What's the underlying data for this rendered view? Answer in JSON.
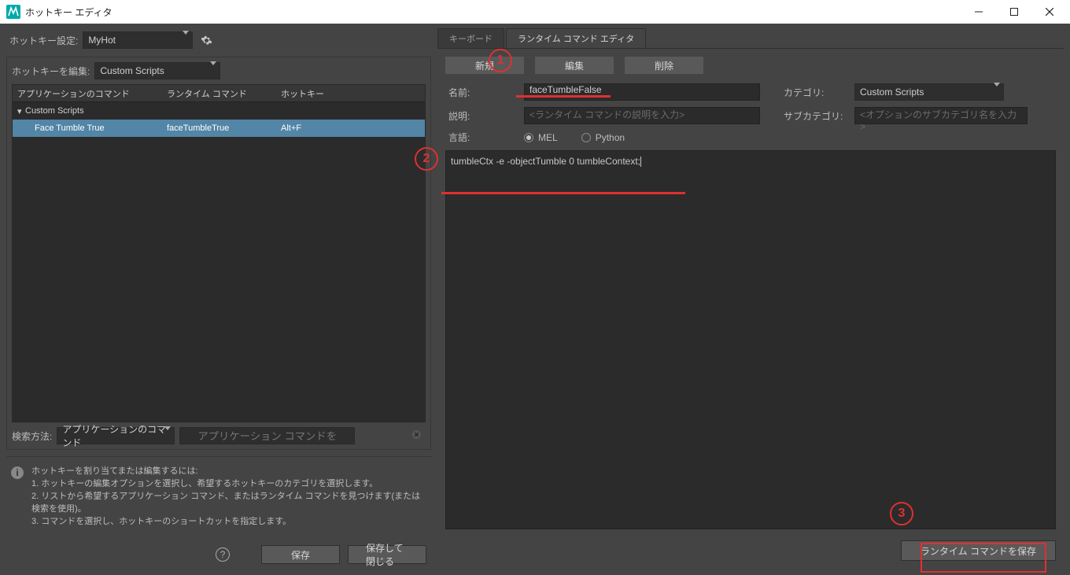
{
  "window": {
    "title": "ホットキー エディタ"
  },
  "hotkeySet": {
    "label": "ホットキー設定:",
    "value": "MyHot"
  },
  "editHotkey": {
    "label": "ホットキーを編集:",
    "value": "Custom Scripts"
  },
  "listHeader": {
    "col1": "アプリケーションのコマンド",
    "col2": "ランタイム コマンド",
    "col3": "ホットキー"
  },
  "tree": {
    "group": "Custom Scripts",
    "row": {
      "name": "Face Tumble True",
      "runtime": "faceTumbleTrue",
      "hotkey": "Alt+F"
    }
  },
  "searchBy": {
    "label": "検索方法:",
    "value": "アプリケーションのコマンド",
    "placeholder": "アプリケーション コマンドを入力..."
  },
  "help": {
    "title": "ホットキーを割り当てまたは編集するには:",
    "l1": "1. ホットキーの編集オプションを選択し、希望するホットキーのカテゴリを選択します。",
    "l2": "2. リストから希望するアプリケーション コマンド、またはランタイム コマンドを見つけます(または検索を使用)。",
    "l3": "3. コマンドを選択し、ホットキーのショートカットを指定します。"
  },
  "buttons": {
    "save": "保存",
    "saveClose": "保存して閉じる",
    "saveRuntime": "ランタイム コマンドを保存"
  },
  "tabs": {
    "keyboard": "キーボード",
    "runtime": "ランタイム コマンド エディタ"
  },
  "actionButtons": {
    "new": "新規",
    "edit": "編集",
    "delete": "削除"
  },
  "form": {
    "nameLabel": "名前:",
    "nameValue": "faceTumbleFalse",
    "descLabel": "説明:",
    "descPlaceholder": "<ランタイム コマンドの説明を入力>",
    "langLabel": "言語:",
    "langMel": "MEL",
    "langPython": "Python",
    "catLabel": "カテゴリ:",
    "catValue": "Custom Scripts",
    "subcatLabel": "サブカテゴリ:",
    "subcatPlaceholder": "<オプションのサブカテゴリ名を入力>"
  },
  "code": "tumbleCtx -e -objectTumble 0 tumbleContext;",
  "annotations": {
    "a1": "1",
    "a2": "2",
    "a3": "3"
  }
}
